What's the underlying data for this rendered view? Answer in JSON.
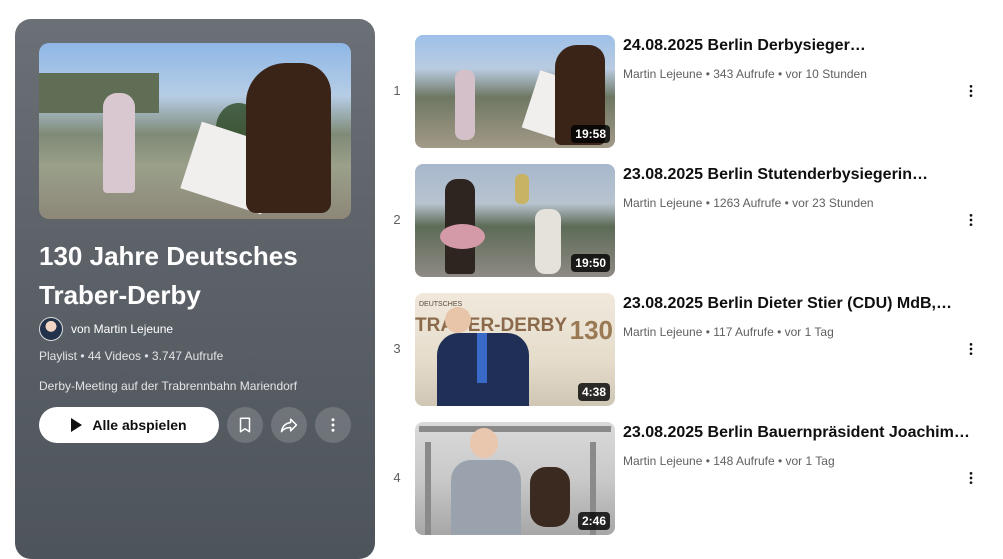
{
  "playlist": {
    "title": "130 Jahre Deutsches Traber-Derby",
    "owner": "von Martin Lejeune",
    "meta": "Playlist • 44 Videos • 3.747 Aufrufe",
    "description": "Derby-Meeting auf der Trabrennbahn Mariendorf",
    "play_all_label": "Alle abspielen"
  },
  "videos": [
    {
      "index": "1",
      "title": "24.08.2025 Berlin Derbysieger…",
      "meta": "Martin Lejeune • 343 Aufrufe • vor 10 Stunden",
      "duration": "19:58"
    },
    {
      "index": "2",
      "title": "23.08.2025 Berlin Stutenderbysiegerin…",
      "meta": "Martin Lejeune • 1263 Aufrufe • vor 23 Stunden",
      "duration": "19:50"
    },
    {
      "index": "3",
      "title": "23.08.2025 Berlin Dieter Stier (CDU) MdB,…",
      "meta": "Martin Lejeune • 117 Aufrufe • vor 1 Tag",
      "duration": "4:38"
    },
    {
      "index": "4",
      "title": "23.08.2025 Berlin Bauernpräsident Joachim…",
      "meta": "Martin Lejeune • 148 Aufrufe • vor 1 Tag",
      "duration": "2:46"
    }
  ],
  "thumb3_text": {
    "brand": "TRABER-DERBY",
    "number": "130",
    "subtitle": "DEUTSCHES"
  },
  "icons": {
    "save": "bookmark-icon",
    "share": "share-icon",
    "more": "more-vertical-icon",
    "play": "play-icon"
  }
}
